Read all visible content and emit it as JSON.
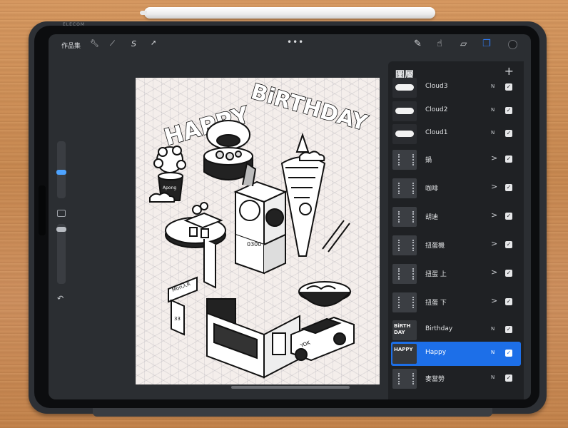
{
  "device": {
    "brand": "ELECOM"
  },
  "toolbar": {
    "gallery_label": "作品集",
    "wrench_icon": "wrench-icon",
    "adjust_icon": "magic-wand-icon",
    "selection_label": "S",
    "transform_icon": "arrow-cursor-icon",
    "menu_dots": "•••",
    "tools": [
      "brush-icon",
      "smudge-icon",
      "eraser-icon",
      "layers-icon",
      "color-swatch"
    ],
    "active_color": "#1f2124",
    "accent": "#2f7cf6"
  },
  "sidebar": {
    "undo_symbol": "↶"
  },
  "canvas": {
    "title_happy": "HAPPY",
    "title_birthday": "BiRTHDAY",
    "cup_text": "Apong",
    "shop_sign": "Mori人R",
    "tag_number": "33",
    "taxi_text": "YOK",
    "machine_text": "0300"
  },
  "layers": {
    "title": "圖層",
    "add_symbol": "+",
    "items": [
      {
        "name": "Cloud3",
        "mode": "N",
        "type": "cloud",
        "visible": true,
        "selected": false
      },
      {
        "name": "Cloud2",
        "mode": "N",
        "type": "cloud",
        "visible": true,
        "selected": false
      },
      {
        "name": "Cloud1",
        "mode": "N",
        "type": "cloud",
        "visible": true,
        "selected": false
      },
      {
        "name": "鍋",
        "mode": ">",
        "type": "group",
        "visible": true,
        "selected": false
      },
      {
        "name": "咖啡",
        "mode": ">",
        "type": "group",
        "visible": true,
        "selected": false
      },
      {
        "name": "胡迪",
        "mode": ">",
        "type": "group",
        "visible": true,
        "selected": false
      },
      {
        "name": "扭蛋機",
        "mode": ">",
        "type": "group",
        "visible": true,
        "selected": false
      },
      {
        "name": "扭蛋 上",
        "mode": ">",
        "type": "group",
        "visible": true,
        "selected": false
      },
      {
        "name": "扭蛋 下",
        "mode": ">",
        "type": "group",
        "visible": true,
        "selected": false
      },
      {
        "name": "Birthday",
        "mode": "N",
        "type": "text",
        "thumb_text": "BiRTH DAY",
        "visible": true,
        "selected": false
      },
      {
        "name": "Happy",
        "mode": "N",
        "type": "text",
        "thumb_text": "HAPPY",
        "visible": true,
        "selected": true
      },
      {
        "name": "麥當勞",
        "mode": "N",
        "type": "group",
        "visible": true,
        "selected": false
      }
    ]
  }
}
